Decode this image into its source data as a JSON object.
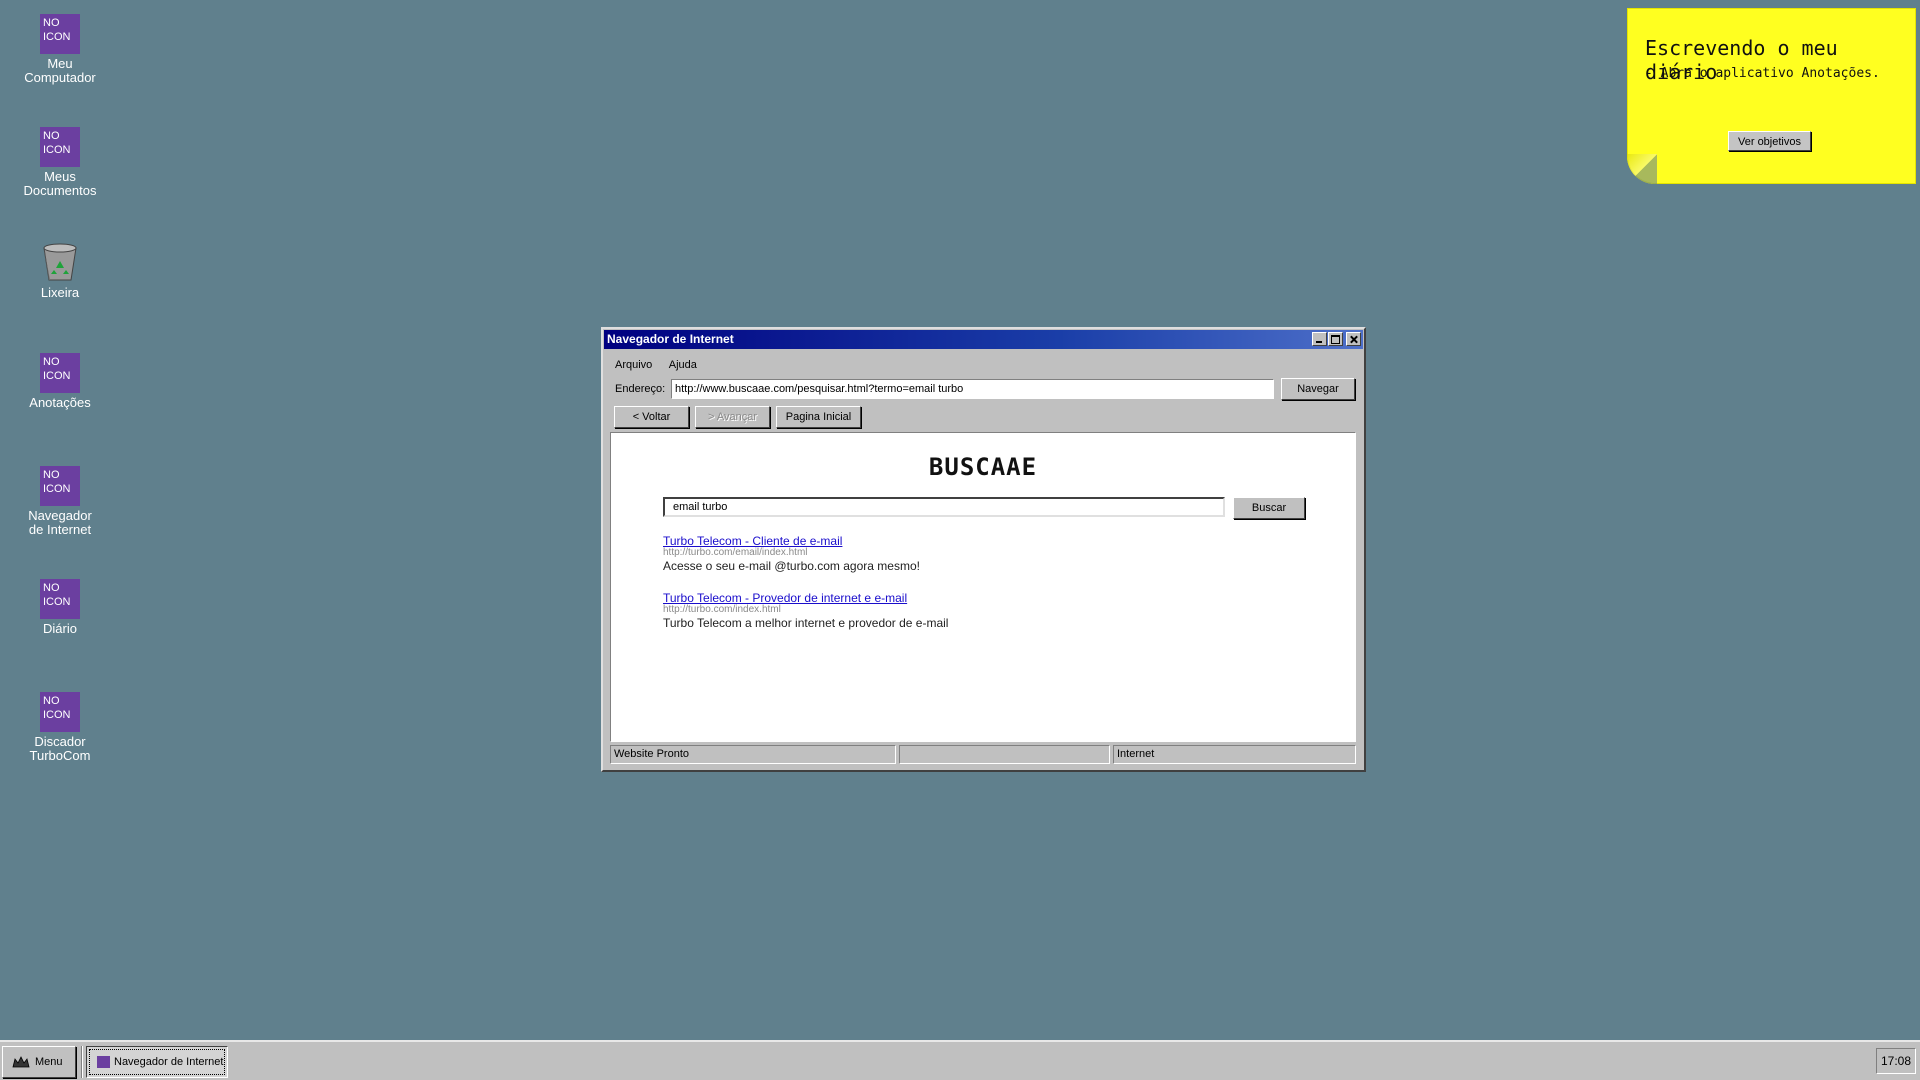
{
  "desktop": {
    "icons": [
      {
        "label": "Meu\nComputador",
        "icon_text": "NO\nICON",
        "icon": "no-icon"
      },
      {
        "label": "Meus\nDocumentos",
        "icon_text": "NO\nICON",
        "icon": "no-icon"
      },
      {
        "label": "Lixeira",
        "icon": "recycle-bin-icon"
      },
      {
        "label": "Anotações",
        "icon_text": "NO\nICON",
        "icon": "no-icon"
      },
      {
        "label": "Navegador\nde Internet",
        "icon_text": "NO\nICON",
        "icon": "no-icon"
      },
      {
        "label": "Diário",
        "icon_text": "NO\nICON",
        "icon": "no-icon"
      },
      {
        "label": "Discador\nTurboCom",
        "icon_text": "NO\nICON",
        "icon": "no-icon"
      }
    ]
  },
  "note": {
    "title": "Escrevendo o meu diário",
    "body": "- Abra o aplicativo Anotações.",
    "button": "Ver objetivos"
  },
  "window": {
    "title": "Navegador de Internet",
    "menu": [
      "Arquivo",
      "Ajuda"
    ],
    "address_label": "Endereço:",
    "address_value": "http://www.buscaae.com/pesquisar.html?termo=email turbo",
    "navigate_button": "Navegar",
    "back_button": "< Voltar",
    "forward_button": "> Avançar",
    "home_button": "Pagina Inicial",
    "status": [
      "Website Pronto",
      "",
      "Internet"
    ]
  },
  "page": {
    "logo": "BUSCAAE",
    "search_value": "email turbo",
    "search_button": "Buscar",
    "results": [
      {
        "title": "Turbo Telecom - Cliente de e-mail",
        "url": "http://turbo.com/email/index.html",
        "desc": "Acesse o seu e-mail @turbo.com agora mesmo!"
      },
      {
        "title": "Turbo Telecom - Provedor de internet e e-mail",
        "url": "http://turbo.com/index.html",
        "desc": "Turbo Telecom a melhor internet e provedor de e-mail"
      }
    ]
  },
  "taskbar": {
    "start_label": "Menu",
    "task_label": "Navegador de Internet",
    "clock": "17:08"
  },
  "colors": {
    "desktop": "#60808d",
    "titlebar": "#000080",
    "note": "#ffff20",
    "noicon": "#6b3fa0",
    "link": "#1a0dcc"
  }
}
